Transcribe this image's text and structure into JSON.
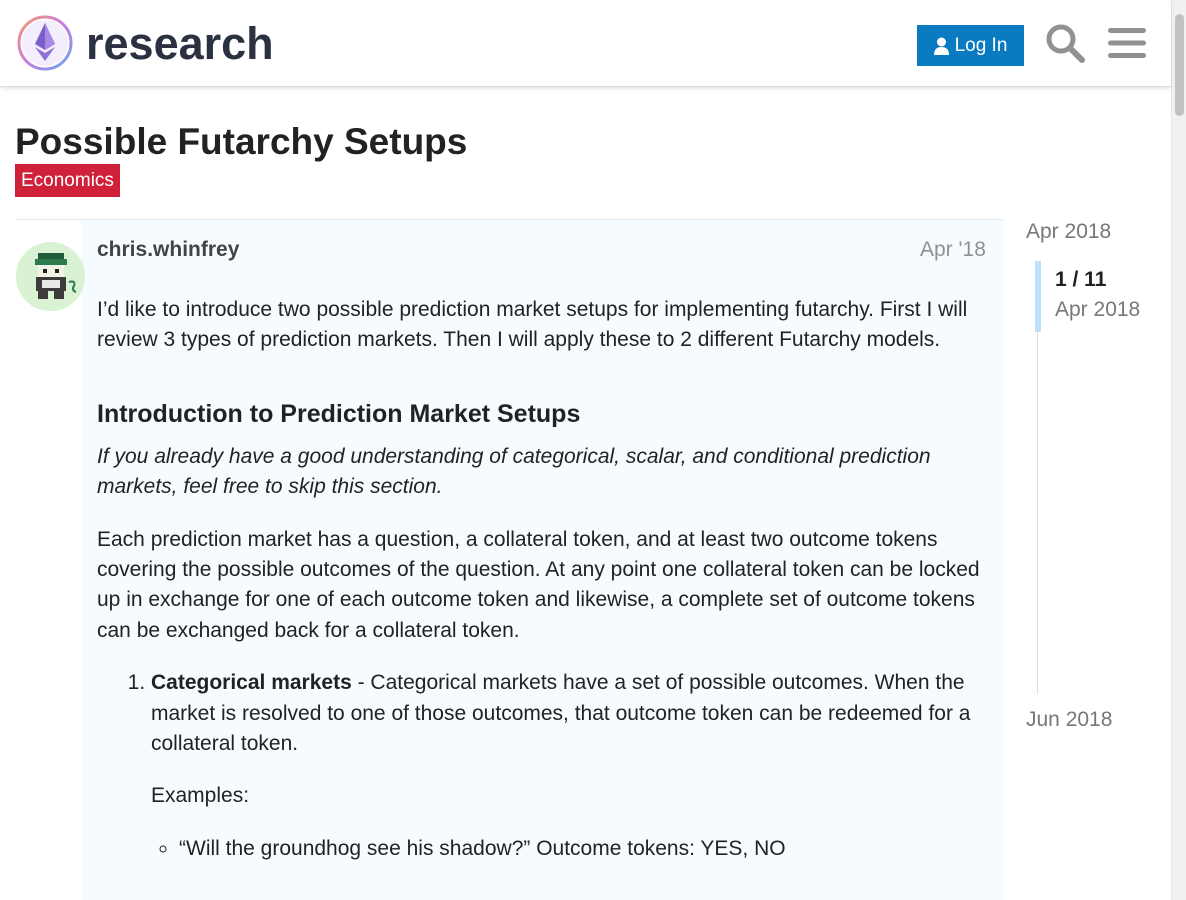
{
  "header": {
    "logo_text": "research",
    "login_label": "Log In"
  },
  "topic": {
    "title": "Possible Futarchy Setups",
    "category": "Economics",
    "category_color": "#d0213a"
  },
  "post": {
    "username": "chris.whinfrey",
    "date": "Apr '18",
    "intro": "I’d like to introduce two possible prediction market setups for implementing futarchy. First I will review 3 types of prediction markets. Then I will apply these to 2 different Futarchy models.",
    "heading": "Introduction to Prediction Market Setups",
    "skip_note": "If you already have a good understanding of categorical, scalar, and conditional prediction markets, feel free to skip this section.",
    "explanation": "Each prediction market has a question, a collateral token, and at least two outcome tokens covering the possible outcomes of the question. At any point one collateral token can be locked up in exchange for one of each outcome token and likewise, a complete set of outcome tokens can be exchanged back for a collateral token.",
    "list": [
      {
        "term": "Categorical markets",
        "desc": " - Categorical markets have a set of possible outcomes. When the market is resolved to one of those outcomes, that outcome token can be redeemed for a collateral token.",
        "examples_label": "Examples:",
        "examples": [
          "“Will the groundhog see his shadow?” Outcome tokens: YES, NO"
        ]
      }
    ]
  },
  "timeline": {
    "start_date": "Apr 2018",
    "position": "1 / 11",
    "position_date": "Apr 2018",
    "end_date": "Jun 2018"
  },
  "colors": {
    "brand_blue": "#0a7ac1",
    "post_background": "#f6fbff"
  }
}
